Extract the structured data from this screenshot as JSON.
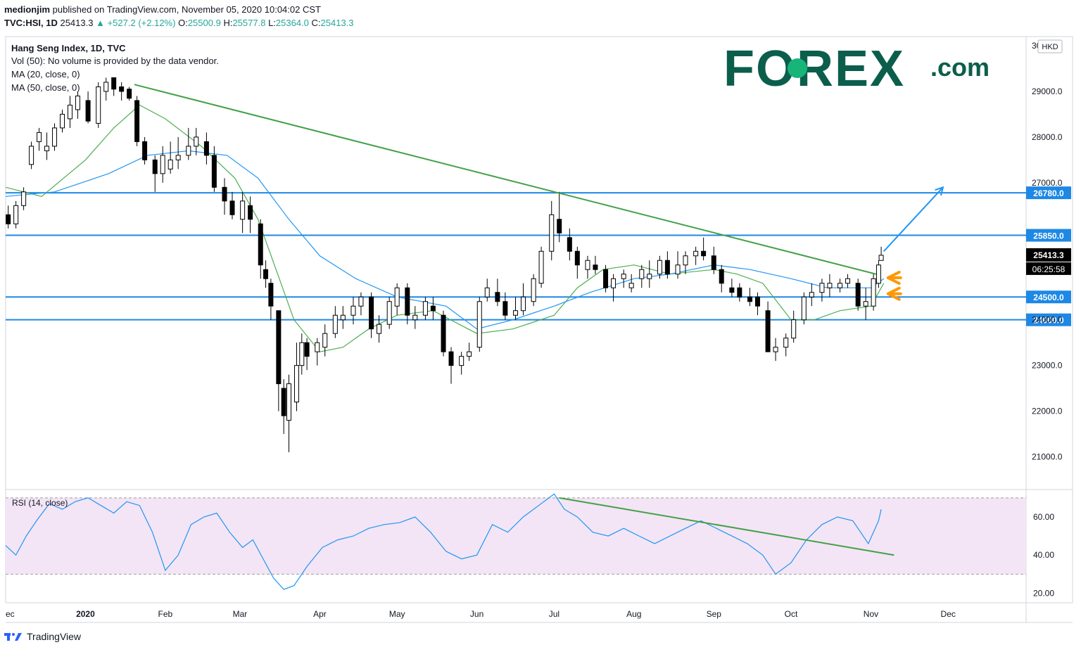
{
  "header": {
    "publisher": "medionjim",
    "published_text": "published on TradingView.com, November 05, 2020 10:04:02 CST",
    "symbol": "TVC:HSI, 1D",
    "last": "25413.3",
    "change": "+527.2 (+2.12%)",
    "open_label": "O:",
    "open": "25500.9",
    "high_label": "H:",
    "high": "25577.8",
    "low_label": "L:",
    "low": "25364.0",
    "close_label": "C:",
    "close": "25413.3"
  },
  "legend": {
    "line1": "Hang Seng Index, 1D, TVC",
    "line2": "Vol (50): No volume is provided by the data vendor.",
    "line3": "MA (20, close, 0)",
    "line4": "MA (50, close, 0)"
  },
  "logo": {
    "brand": "FOREX",
    "suffix": ".com",
    "color": "#0b5e4b",
    "accent": "#17b57a"
  },
  "currency_badge": "HKD",
  "countdown": "06:25:58",
  "rsi_label": "RSI (14, close)",
  "footer": {
    "brand": "TradingView"
  },
  "colors": {
    "up_candle": "#ffffff",
    "down_candle": "#000000",
    "ma20": "#4caf50",
    "ma50": "#2196f3",
    "level": "#1e88e5",
    "trend": "#43a047",
    "arrow": "#ff9800",
    "rsi_line": "#2196f3",
    "rsi_band": "#f3e5f5"
  },
  "chart_data": [
    {
      "type": "candlestick",
      "title": "Hang Seng Index, 1D, TVC",
      "ylim": [
        20300,
        30200
      ],
      "yticks": [
        21000,
        22000,
        23000,
        24000,
        25000,
        26000,
        27000,
        28000,
        29000,
        30000
      ],
      "ytick_labels": [
        "21000.0",
        "22000.0",
        "23000.0",
        "24000.0",
        "",
        "",
        "27000.0",
        "28000.0",
        "29000.0",
        "30000.0"
      ],
      "x_start": "2019-12-01",
      "x_end": "2020-12-31",
      "xticks": [
        {
          "date": "2019-12-01",
          "label": "ec"
        },
        {
          "date": "2020-01-01",
          "label": "2020"
        },
        {
          "date": "2020-02-01",
          "label": "Feb"
        },
        {
          "date": "2020-03-01",
          "label": "Mar"
        },
        {
          "date": "2020-04-01",
          "label": "Apr"
        },
        {
          "date": "2020-05-01",
          "label": "May"
        },
        {
          "date": "2020-06-01",
          "label": "Jun"
        },
        {
          "date": "2020-07-01",
          "label": "Jul"
        },
        {
          "date": "2020-08-01",
          "label": "Aug"
        },
        {
          "date": "2020-09-01",
          "label": "Sep"
        },
        {
          "date": "2020-10-01",
          "label": "Oct"
        },
        {
          "date": "2020-11-01",
          "label": "Nov"
        },
        {
          "date": "2020-12-01",
          "label": "Dec"
        }
      ],
      "horizontal_levels": [
        {
          "value": 26780,
          "label": "26780.0"
        },
        {
          "value": 25850,
          "label": "25850.0"
        },
        {
          "value": 24500,
          "label": "24500.0"
        },
        {
          "value": 24000,
          "label": "24000.0"
        }
      ],
      "price_marker": {
        "value": 25413.3,
        "label": "25413.3"
      },
      "trendline": {
        "from": {
          "date": "2020-01-20",
          "value": 29150
        },
        "to": {
          "date": "2020-11-03",
          "value": 25000
        }
      },
      "projection_arrow": {
        "from": {
          "date": "2020-11-06",
          "value": 25500
        },
        "to": {
          "date": "2020-11-29",
          "value": 26900
        }
      },
      "arrow_markers": [
        {
          "date": "2020-11-06",
          "value": 24920
        },
        {
          "date": "2020-11-06",
          "value": 24570
        }
      ],
      "candles": {
        "dates": [
          "2019-12-02",
          "2019-12-05",
          "2019-12-08",
          "2019-12-11",
          "2019-12-14",
          "2019-12-17",
          "2019-12-20",
          "2019-12-23",
          "2019-12-26",
          "2019-12-29",
          "2020-01-02",
          "2020-01-06",
          "2020-01-09",
          "2020-01-12",
          "2020-01-15",
          "2020-01-18",
          "2020-01-21",
          "2020-01-24",
          "2020-01-28",
          "2020-01-31",
          "2020-02-03",
          "2020-02-06",
          "2020-02-10",
          "2020-02-13",
          "2020-02-17",
          "2020-02-20",
          "2020-02-24",
          "2020-02-27",
          "2020-03-02",
          "2020-03-05",
          "2020-03-09",
          "2020-03-11",
          "2020-03-13",
          "2020-03-16",
          "2020-03-18",
          "2020-03-20",
          "2020-03-23",
          "2020-03-25",
          "2020-03-27",
          "2020-03-31",
          "2020-04-03",
          "2020-04-07",
          "2020-04-10",
          "2020-04-14",
          "2020-04-17",
          "2020-04-21",
          "2020-04-24",
          "2020-04-28",
          "2020-05-01",
          "2020-05-05",
          "2020-05-08",
          "2020-05-12",
          "2020-05-15",
          "2020-05-19",
          "2020-05-22",
          "2020-05-26",
          "2020-05-29",
          "2020-06-02",
          "2020-06-05",
          "2020-06-09",
          "2020-06-12",
          "2020-06-16",
          "2020-06-19",
          "2020-06-23",
          "2020-06-26",
          "2020-06-30",
          "2020-07-03",
          "2020-07-07",
          "2020-07-10",
          "2020-07-14",
          "2020-07-17",
          "2020-07-21",
          "2020-07-24",
          "2020-07-28",
          "2020-07-31",
          "2020-08-04",
          "2020-08-07",
          "2020-08-11",
          "2020-08-14",
          "2020-08-18",
          "2020-08-21",
          "2020-08-25",
          "2020-08-28",
          "2020-09-01",
          "2020-09-04",
          "2020-09-08",
          "2020-09-11",
          "2020-09-15",
          "2020-09-18",
          "2020-09-22",
          "2020-09-25",
          "2020-09-29",
          "2020-10-02",
          "2020-10-06",
          "2020-10-09",
          "2020-10-13",
          "2020-10-16",
          "2020-10-20",
          "2020-10-23",
          "2020-10-27",
          "2020-10-30",
          "2020-11-02",
          "2020-11-04",
          "2020-11-05"
        ],
        "open": [
          26300,
          26100,
          26500,
          27400,
          27900,
          27700,
          27800,
          28200,
          28400,
          28600,
          28800,
          28300,
          29000,
          29300,
          29100,
          29050,
          28800,
          27900,
          27500,
          27200,
          27300,
          27500,
          27600,
          27800,
          27900,
          27600,
          26900,
          26600,
          26200,
          26500,
          26100,
          25100,
          24800,
          24200,
          22500,
          21800,
          22200,
          23000,
          23500,
          23300,
          23400,
          23700,
          24000,
          24100,
          24300,
          24500,
          23700,
          23900,
          24300,
          24700,
          24000,
          24100,
          24300,
          24100,
          23300,
          23000,
          23200,
          23400,
          24500,
          24600,
          24400,
          24100,
          24200,
          24400,
          24800,
          25500,
          26200,
          25800,
          25500,
          25100,
          25200,
          25100,
          24700,
          24900,
          24700,
          24900,
          24900,
          25000,
          25300,
          25000,
          25200,
          25400,
          25500,
          25400,
          25100,
          24700,
          24700,
          24500,
          24500,
          24200,
          23300,
          23400,
          23600,
          24000,
          24500,
          24600,
          24700,
          24700,
          24800,
          24800,
          24300,
          24300,
          24800,
          25300
        ],
        "high": [
          26500,
          26600,
          26900,
          27900,
          28200,
          28100,
          28300,
          28600,
          28900,
          29000,
          29000,
          29200,
          29300,
          29200,
          29200,
          29100,
          28900,
          28000,
          27600,
          27800,
          27900,
          28000,
          28200,
          28200,
          28100,
          27800,
          27100,
          26800,
          26800,
          26700,
          26200,
          25300,
          24900,
          24200,
          22700,
          22800,
          23500,
          23700,
          23600,
          23600,
          23900,
          24300,
          24300,
          24500,
          24600,
          24600,
          24100,
          24500,
          24800,
          24800,
          24300,
          24500,
          24500,
          24200,
          23400,
          23300,
          23500,
          24500,
          24900,
          24900,
          24600,
          24500,
          24800,
          25000,
          25600,
          26600,
          26800,
          26000,
          25600,
          25400,
          25400,
          25200,
          25000,
          25100,
          25000,
          25200,
          25300,
          25400,
          25500,
          25500,
          25500,
          25600,
          25800,
          25600,
          25200,
          24900,
          24800,
          24700,
          24600,
          24400,
          23600,
          23700,
          24200,
          24600,
          24800,
          24900,
          25000,
          24900,
          25000,
          24900,
          24700,
          25000,
          25300,
          25600
        ],
        "low": [
          26000,
          26000,
          26400,
          27300,
          27700,
          27500,
          27700,
          28100,
          28200,
          28400,
          28300,
          28200,
          28800,
          28900,
          28800,
          28800,
          27800,
          27400,
          26800,
          27000,
          27200,
          27300,
          27500,
          27600,
          27400,
          26800,
          26300,
          26200,
          25900,
          25900,
          24900,
          24700,
          24000,
          22000,
          21500,
          21100,
          22000,
          22800,
          22900,
          23000,
          23200,
          23600,
          23800,
          23900,
          24100,
          23600,
          23500,
          23800,
          24100,
          23900,
          23800,
          24000,
          24000,
          23200,
          22600,
          22800,
          23100,
          23300,
          24400,
          24300,
          24000,
          24000,
          24100,
          24300,
          24700,
          25300,
          25700,
          25300,
          24900,
          24900,
          25000,
          24600,
          24400,
          24700,
          24600,
          24700,
          24700,
          24900,
          24900,
          24900,
          25000,
          25200,
          25300,
          25000,
          24600,
          24500,
          24400,
          24300,
          24100,
          23300,
          23100,
          23200,
          23500,
          23900,
          24300,
          24400,
          24500,
          24600,
          24700,
          24200,
          24000,
          24200,
          24700,
          25364
        ],
        "close": [
          26100,
          26500,
          26800,
          27800,
          28100,
          27800,
          28200,
          28500,
          28700,
          28900,
          28350,
          29100,
          29200,
          29050,
          29000,
          28850,
          27900,
          27500,
          27200,
          27600,
          27500,
          27600,
          27800,
          28000,
          27600,
          26900,
          26600,
          26300,
          26600,
          26200,
          25200,
          24900,
          24300,
          22600,
          21900,
          22600,
          23000,
          23500,
          23200,
          23500,
          23700,
          24100,
          24100,
          24300,
          24500,
          23800,
          23900,
          24400,
          24700,
          24100,
          24100,
          24400,
          24200,
          23300,
          23000,
          23200,
          23300,
          24400,
          24700,
          24400,
          24100,
          24200,
          24500,
          24900,
          25500,
          26300,
          25900,
          25500,
          25200,
          25300,
          25100,
          24700,
          24900,
          25000,
          24800,
          25100,
          25000,
          25300,
          25000,
          25200,
          25400,
          25500,
          25400,
          25100,
          24800,
          24600,
          24500,
          24400,
          24300,
          23300,
          23400,
          23600,
          24000,
          24500,
          24600,
          24800,
          24800,
          24800,
          24900,
          24300,
          24400,
          24900,
          25200,
          25413.3
        ]
      },
      "ma20": {
        "dates": [
          "2019-12-01",
          "2019-12-15",
          "2020-01-01",
          "2020-01-12",
          "2020-01-22",
          "2020-02-01",
          "2020-02-15",
          "2020-02-28",
          "2020-03-08",
          "2020-03-15",
          "2020-03-22",
          "2020-04-01",
          "2020-04-10",
          "2020-04-20",
          "2020-05-01",
          "2020-05-15",
          "2020-06-01",
          "2020-06-15",
          "2020-07-01",
          "2020-07-10",
          "2020-07-20",
          "2020-08-01",
          "2020-08-15",
          "2020-09-01",
          "2020-09-10",
          "2020-09-20",
          "2020-10-01",
          "2020-10-10",
          "2020-10-20",
          "2020-11-01",
          "2020-11-06"
        ],
        "values": [
          26900,
          26700,
          27500,
          28200,
          28700,
          28400,
          27800,
          27100,
          26200,
          25100,
          24000,
          23300,
          23400,
          23800,
          24100,
          24200,
          23700,
          23800,
          24100,
          24700,
          25100,
          25200,
          25000,
          25100,
          25000,
          24800,
          24000,
          24000,
          24200,
          24300,
          24800
        ]
      },
      "ma50": {
        "dates": [
          "2019-12-01",
          "2019-12-20",
          "2020-01-10",
          "2020-01-25",
          "2020-02-10",
          "2020-02-25",
          "2020-03-08",
          "2020-03-20",
          "2020-04-01",
          "2020-04-15",
          "2020-05-01",
          "2020-05-20",
          "2020-06-01",
          "2020-06-15",
          "2020-07-01",
          "2020-07-15",
          "2020-08-01",
          "2020-08-15",
          "2020-09-01",
          "2020-09-15",
          "2020-10-01",
          "2020-10-15",
          "2020-11-01",
          "2020-11-06"
        ],
        "values": [
          26700,
          26800,
          27200,
          27600,
          27700,
          27600,
          27100,
          26200,
          25400,
          24900,
          24500,
          24300,
          23800,
          24000,
          24300,
          24600,
          24900,
          25000,
          25200,
          25100,
          24900,
          24700,
          24700,
          24900
        ]
      }
    },
    {
      "type": "line",
      "title": "RSI (14, close)",
      "ylim": [
        15,
        74
      ],
      "yticks": [
        20,
        40,
        60
      ],
      "ytick_labels": [
        "20.00",
        "40.00",
        "60.00"
      ],
      "band": [
        30,
        70
      ],
      "trendline": {
        "from": {
          "date": "2020-07-03",
          "value": 70
        },
        "to": {
          "date": "2020-11-10",
          "value": 40
        }
      },
      "dates": [
        "2019-12-01",
        "2019-12-05",
        "2019-12-09",
        "2019-12-13",
        "2019-12-18",
        "2019-12-23",
        "2019-12-28",
        "2020-01-02",
        "2020-01-07",
        "2020-01-12",
        "2020-01-17",
        "2020-01-22",
        "2020-01-27",
        "2020-02-01",
        "2020-02-06",
        "2020-02-11",
        "2020-02-16",
        "2020-02-21",
        "2020-02-26",
        "2020-03-02",
        "2020-03-06",
        "2020-03-10",
        "2020-03-14",
        "2020-03-18",
        "2020-03-22",
        "2020-03-27",
        "2020-04-02",
        "2020-04-08",
        "2020-04-14",
        "2020-04-20",
        "2020-04-26",
        "2020-05-02",
        "2020-05-08",
        "2020-05-14",
        "2020-05-20",
        "2020-05-26",
        "2020-06-01",
        "2020-06-07",
        "2020-06-13",
        "2020-06-19",
        "2020-06-25",
        "2020-07-01",
        "2020-07-05",
        "2020-07-10",
        "2020-07-16",
        "2020-07-22",
        "2020-07-28",
        "2020-08-03",
        "2020-08-09",
        "2020-08-15",
        "2020-08-21",
        "2020-08-27",
        "2020-09-02",
        "2020-09-08",
        "2020-09-14",
        "2020-09-20",
        "2020-09-25",
        "2020-10-01",
        "2020-10-07",
        "2020-10-13",
        "2020-10-19",
        "2020-10-25",
        "2020-10-31",
        "2020-11-04",
        "2020-11-05"
      ],
      "values": [
        45,
        40,
        50,
        58,
        67,
        64,
        68,
        70,
        66,
        62,
        68,
        66,
        52,
        32,
        40,
        56,
        60,
        62,
        52,
        44,
        48,
        38,
        28,
        22,
        24,
        34,
        44,
        48,
        50,
        54,
        56,
        57,
        60,
        52,
        42,
        38,
        40,
        56,
        52,
        60,
        66,
        72,
        64,
        60,
        52,
        50,
        54,
        50,
        46,
        50,
        54,
        58,
        54,
        50,
        46,
        40,
        30,
        36,
        48,
        56,
        60,
        58,
        46,
        58,
        64
      ]
    }
  ]
}
